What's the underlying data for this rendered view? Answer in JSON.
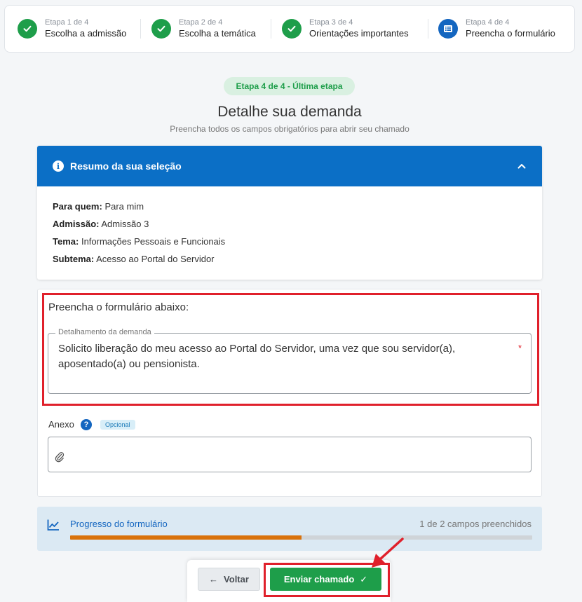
{
  "stepper": {
    "steps": [
      {
        "small": "Etapa 1 de 4",
        "big": "Escolha a admissão",
        "status": "done"
      },
      {
        "small": "Etapa 2 de 4",
        "big": "Escolha a temática",
        "status": "done"
      },
      {
        "small": "Etapa 3 de 4",
        "big": "Orientações importantes",
        "status": "done"
      },
      {
        "small": "Etapa 4 de 4",
        "big": "Preencha o formulário",
        "status": "current"
      }
    ]
  },
  "header": {
    "badge": "Etapa 4 de 4 - Última etapa",
    "title": "Detalhe sua demanda",
    "subtitle": "Preencha todos os campos obrigatórios para abrir seu chamado"
  },
  "summary": {
    "title": "Resumo da sua seleção",
    "info_glyph": "i",
    "rows": [
      {
        "label": "Para quem:",
        "value": "Para mim"
      },
      {
        "label": "Admissão:",
        "value": "Admissão 3"
      },
      {
        "label": "Tema:",
        "value": "Informações Pessoais e Funcionais"
      },
      {
        "label": "Subtema:",
        "value": "Acesso ao Portal do Servidor"
      }
    ]
  },
  "form": {
    "title": "Preencha o formulário abaixo:",
    "field_label": "Detalhamento da demanda",
    "field_value": "Solicito liberação do meu acesso ao Portal do Servidor, uma vez que sou servidor(a), aposentado(a) ou pensionista.",
    "required_mark": "*",
    "anexo_label": "Anexo",
    "help_glyph": "?",
    "optional_badge": "Opcional"
  },
  "progress": {
    "title": "Progresso do formulário",
    "count_text": "1 de 2 campos preenchidos",
    "fraction": 0.5
  },
  "buttons": {
    "back": "Voltar",
    "back_glyph": "←",
    "send": "Enviar chamado",
    "send_glyph": "✓"
  },
  "colors": {
    "done": "#1e9e4a",
    "current": "#1466c0",
    "header_blue": "#0b6fc6",
    "progress_fill": "#d9720a",
    "highlight_red": "#e0202b"
  }
}
